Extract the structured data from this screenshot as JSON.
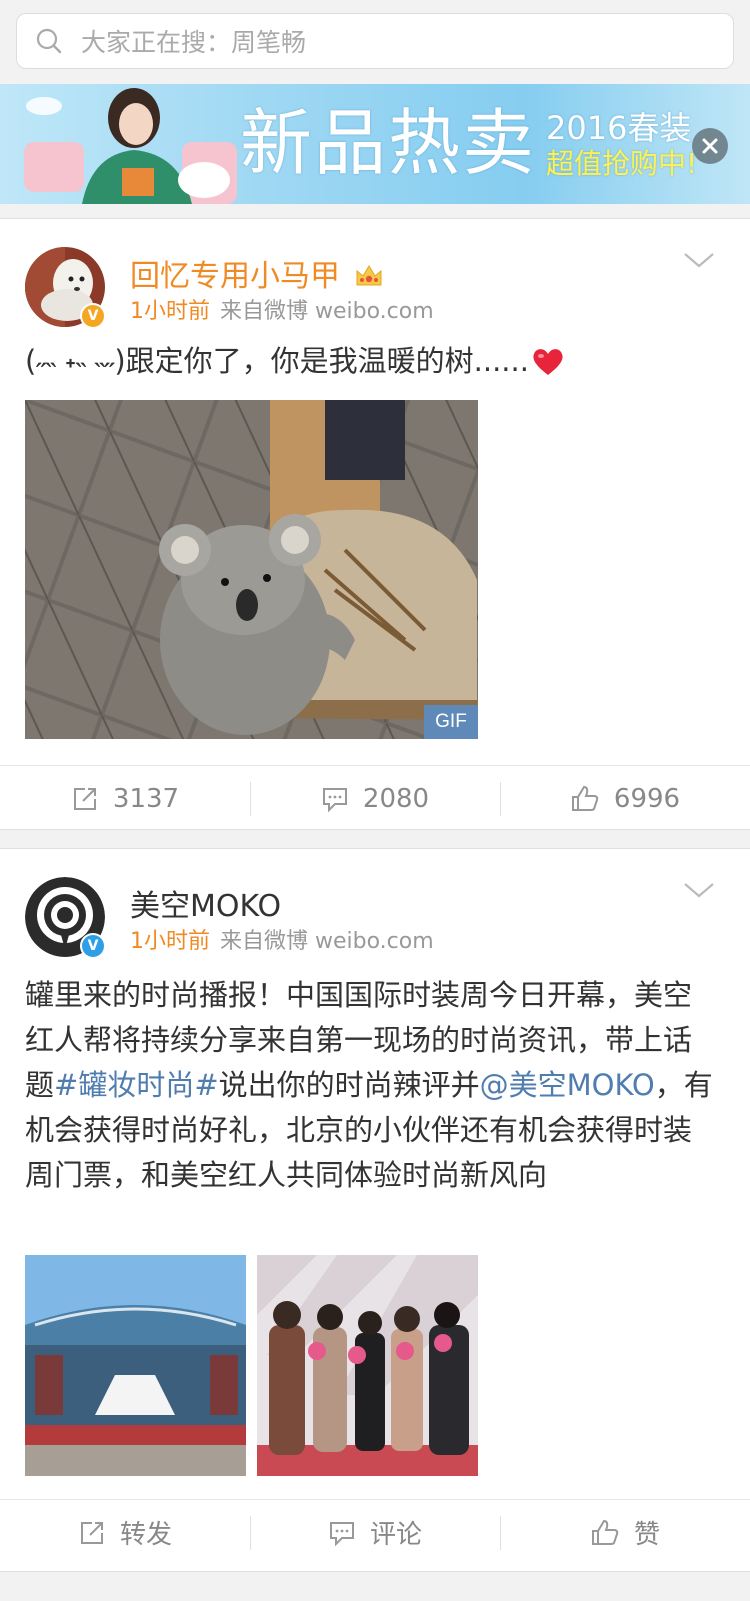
{
  "search": {
    "placeholder": "大家正在搜：周笔畅"
  },
  "banner": {
    "title": "新品热卖",
    "sub1": "2016春装",
    "sub2": "超值抢购中!"
  },
  "posts": [
    {
      "username": "回忆专用小马甲",
      "username_color": "#f08a24",
      "time": "1小时前",
      "source": "来自微博 weibo.com",
      "text": "(˶˵ ˖˵ ˵˶)跟定你了，你是我温暖的树......",
      "media_badge": "GIF",
      "actions": {
        "repost": "3137",
        "comment": "2080",
        "like": "6996"
      }
    },
    {
      "username": "美空MOKO",
      "username_color": "#333333",
      "time": "1小时前",
      "source": "来自微博 weibo.com",
      "text_parts": {
        "a": "罐里来的时尚播报！中国国际时装周今日开幕，美空红人帮将持续分享来自第一现场的时尚资讯，带上话题",
        "topic": "#罐妆时尚#",
        "b": "说出你的时尚辣评并",
        "mention": "@美空MOKO",
        "c": "，有机会获得时尚好礼，北京的小伙伴还有机会获得时装周门票，和美空红人共同体验时尚新风向"
      },
      "actions": {
        "repost": "转发",
        "comment": "评论",
        "like": "赞"
      }
    }
  ]
}
